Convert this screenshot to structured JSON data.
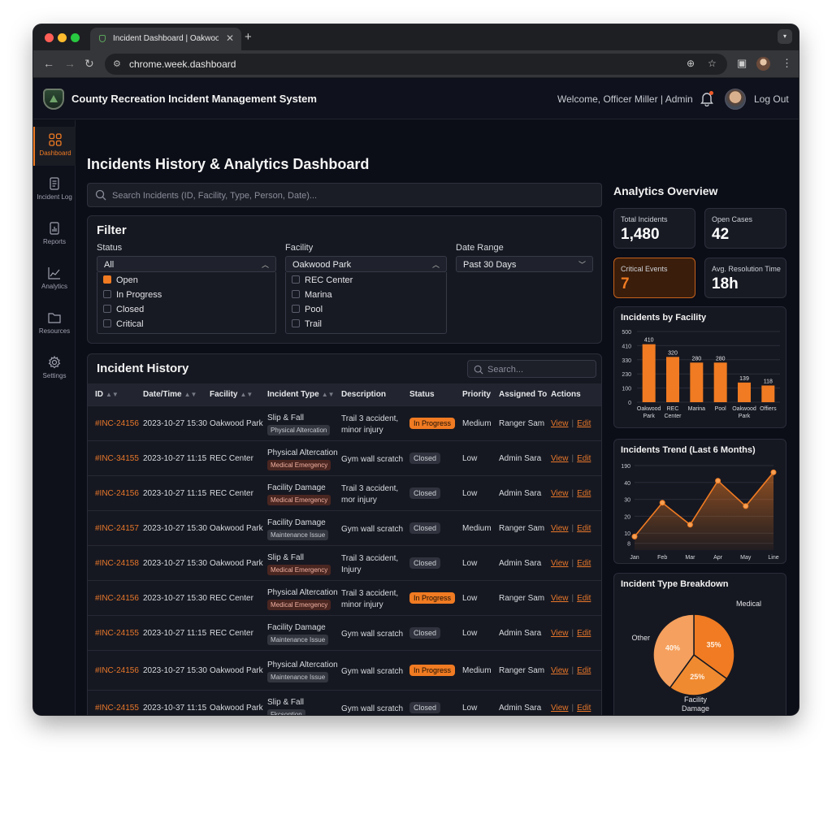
{
  "browser": {
    "tab_title": "Incident Dashboard | Oakwoo",
    "url": "chrome.week.dashboard"
  },
  "app": {
    "title": "County Recreation Incident Management System",
    "welcome": "Welcome, Officer Miller | Admin",
    "logout": "Log Out"
  },
  "sidebar": {
    "items": [
      {
        "label": "Dashboard",
        "icon": "grid-icon"
      },
      {
        "label": "Incident Log",
        "icon": "document-icon"
      },
      {
        "label": "Reports",
        "icon": "report-icon"
      },
      {
        "label": "Analytics",
        "icon": "line-chart-icon"
      },
      {
        "label": "Resources",
        "icon": "folder-icon"
      },
      {
        "label": "Settings",
        "icon": "gear-icon"
      }
    ]
  },
  "main": {
    "title": "Incidents History & Analytics Dashboard",
    "search_placeholder": "Search Incidents (ID, Facility, Type, Person, Date)..."
  },
  "filter": {
    "title": "Filter",
    "status_label": "Status",
    "status_value": "All",
    "status_options": [
      "Open",
      "In Progress",
      "Closed",
      "Critical"
    ],
    "facility_label": "Facility",
    "facility_value": "Oakwood Park",
    "facility_options": [
      "REC Center",
      "Marina",
      "Pool",
      "Trail"
    ],
    "date_label": "Date Range",
    "date_value": "Past 30 Days"
  },
  "history": {
    "title": "Incident History",
    "search_placeholder": "Search...",
    "columns": [
      "ID",
      "Date/Time",
      "Facility",
      "Incident Type",
      "Description",
      "Status",
      "Priority",
      "Assigned To",
      "Actions"
    ],
    "view_label": "View",
    "edit_label": "Edit",
    "rows": [
      {
        "id": "#INC-24156",
        "datetime": "2023-10-27 15:30",
        "facility": "Oakwood Park",
        "type": "Slip & Fall",
        "tag": "Physical Altercation",
        "desc1": "Trail 3 accident,",
        "desc2": "minor injury",
        "status": "In Progress",
        "priority": "Medium",
        "assigned": "Ranger Sam"
      },
      {
        "id": "#INC-34155",
        "datetime": "2023-10-27 11:15",
        "facility": "REC Center",
        "type": "Physical Altercation",
        "tag": "Medical Emergency",
        "desc1": "Gym wall scratch",
        "desc2": "",
        "status": "Closed",
        "priority": "Low",
        "assigned": "Admin Sara"
      },
      {
        "id": "#INC-24156",
        "datetime": "2023-10-27 11:15",
        "facility": "REC Center",
        "type": "Facility Damage",
        "tag": "Medical Emergency",
        "desc1": "Trail 3 accident,",
        "desc2": "mor injury",
        "status": "Closed",
        "priority": "Low",
        "assigned": "Admin Sara"
      },
      {
        "id": "#INC-24157",
        "datetime": "2023-10-27 15:30",
        "facility": "Oakwood Park",
        "type": "Facility Damage",
        "tag": "Maintenance Issue",
        "desc1": "Gym wall scratch",
        "desc2": "",
        "status": "Closed",
        "priority": "Medium",
        "assigned": "Ranger Sam"
      },
      {
        "id": "#INC-24158",
        "datetime": "2023-10-27 15:30",
        "facility": "Oakwood Park",
        "type": "Slip & Fall",
        "tag": "Medical Emergency",
        "desc1": "Trail 3 accident,",
        "desc2": "Injury",
        "status": "Closed",
        "priority": "Low",
        "assigned": "Admin Sara"
      },
      {
        "id": "#INC-24156",
        "datetime": "2023-10-27 15:30",
        "facility": "REC Center",
        "type": "Physical Altercation",
        "tag": "Medical Emergency",
        "desc1": "Trail 3 accident,",
        "desc2": "minor injury",
        "status": "In Progress",
        "priority": "Low",
        "assigned": "Ranger Sam"
      },
      {
        "id": "#INC-24155",
        "datetime": "2023-10-27 11:15",
        "facility": "REC Center",
        "type": "Facility Damage",
        "tag": "Maintenance Issue",
        "desc1": "Gym wall scratch",
        "desc2": "",
        "status": "Closed",
        "priority": "Low",
        "assigned": "Admin Sara"
      },
      {
        "id": "#INC-24156",
        "datetime": "2023-10-27 15:30",
        "facility": "Oakwood Park",
        "type": "Physical Altercation",
        "tag": "Maintenance Issue",
        "desc1": "Gym wall scratch",
        "desc2": "",
        "status": "In Progress",
        "priority": "Medium",
        "assigned": "Ranger Sam"
      },
      {
        "id": "#INC-24155",
        "datetime": "2023-10-37 11:15",
        "facility": "Oakwood Park",
        "type": "Slip & Fall",
        "tag": "Fkcsoption",
        "desc1": "Gym wall scratch",
        "desc2": "",
        "status": "Closed",
        "priority": "Low",
        "assigned": "Admin Sara"
      }
    ]
  },
  "analytics": {
    "title": "Analytics Overview",
    "kpis": [
      {
        "label": "Total Incidents",
        "value": "1,480"
      },
      {
        "label": "Open Cases",
        "value": "42"
      },
      {
        "label": "Critical Events",
        "value": "7"
      },
      {
        "label": "Avg. Resolution Time",
        "value": "18h"
      }
    ]
  },
  "colors": {
    "accent": "#f07b22",
    "background": "#0b0d17",
    "panel": "#161821"
  },
  "chart_data": [
    {
      "type": "bar",
      "title": "Incidents by Facility",
      "categories": [
        "Oakwood Park",
        "REC Center",
        "Marina",
        "Pool",
        "Oakwood Park",
        "Offiers"
      ],
      "category_lines": [
        [
          "Oakwood",
          "Park"
        ],
        [
          "REC",
          "Center"
        ],
        [
          "Marina"
        ],
        [
          "Pool"
        ],
        [
          "Oakwood",
          "Park"
        ],
        [
          "Offiers"
        ]
      ],
      "values": [
        410,
        320,
        280,
        280,
        139,
        118
      ],
      "value_labels": [
        "410",
        "320",
        "280",
        "280",
        "139",
        "118"
      ],
      "yticks": [
        "0",
        "100",
        "230",
        "330",
        "410",
        "500"
      ],
      "ylim": [
        0,
        500
      ]
    },
    {
      "type": "area",
      "title": "Incidents Trend (Last 6 Months)",
      "categories": [
        "Jan",
        "Feb",
        "Mar",
        "Apr",
        "May",
        "Line"
      ],
      "values": [
        8,
        28,
        15,
        41,
        26,
        46
      ],
      "yticks": [
        "8",
        "10",
        "20",
        "30",
        "40",
        "190"
      ],
      "ylim": [
        0,
        50
      ]
    },
    {
      "type": "pie",
      "title": "Incident Type Breakdown",
      "slices": [
        {
          "label": "Medical",
          "value": 35,
          "pct": "35%"
        },
        {
          "label": "Facility Damage",
          "value": 25,
          "pct": "25%"
        },
        {
          "label": "Other",
          "value": 40,
          "pct": "40%"
        }
      ]
    }
  ]
}
